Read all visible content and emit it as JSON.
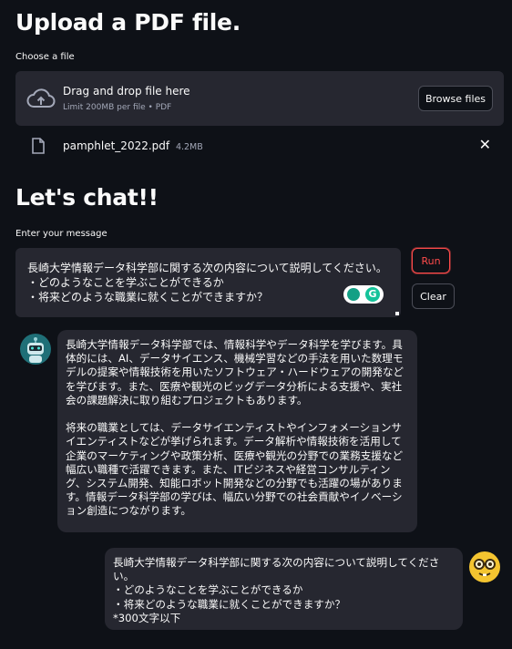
{
  "upload_section": {
    "heading": "Upload a PDF file.",
    "label": "Choose a file",
    "dropzone_title": "Drag and drop file here",
    "dropzone_subtitle": "Limit 200MB per file • PDF",
    "browse_button": "Browse files",
    "upload_icon": "cloud-upload-icon"
  },
  "uploaded_file": {
    "name": "pamphlet_2022.pdf",
    "size": "4.2MB",
    "file_icon": "file-icon",
    "remove_icon": "close-icon",
    "remove_glyph": "✕"
  },
  "chat_section": {
    "heading": "Let's chat!!",
    "input_label": "Enter your message",
    "input_value": "長崎大学情報データ科学部に関する次の内容について説明してください。\n・どのようなことを学ぶことができるか\n・将来どのような職業に就くことができますか？",
    "run_button": "Run",
    "clear_button": "Clear",
    "grammar_glyph": "G"
  },
  "messages": [
    {
      "role": "assistant",
      "avatar_icon": "robot-avatar-icon",
      "text": "長崎大学情報データ科学部では、情報科学やデータ科学を学びます。具体的には、AI、データサイエンス、機械学習などの手法を用いた数理モデルの提案や情報技術を用いたソフトウェア・ハードウェアの開発などを学びます。また、医療や観光のビッグデータ分析による支援や、実社会の課題解決に取り組むプロジェクトもあります。\n\n将来の職業としては、データサイエンティストやインフォメーションサイエンティストなどが挙げられます。データ解析や情報技術を活用して企業のマーケティングや政策分析、医療や観光の分野での業務支援など幅広い職種で活躍できます。また、ITビジネスや経営コンサルティング、システム開発、知能ロボット開発などの分野でも活躍の場があります。情報データ科学部の学びは、幅広い分野での社会貢献やイノベーション創造につながります。"
    },
    {
      "role": "user",
      "avatar_icon": "nerd-face-avatar-icon",
      "text": "長崎大学情報データ科学部に関する次の内容について説明してください。\n・どのようなことを学ぶことができるか\n・将来どのような職業に就くことができますか？\n*300文字以下"
    }
  ],
  "colors": {
    "background": "#0e1117",
    "surface": "#262730",
    "accent": "#ff4b4b",
    "text": "#fafafa",
    "muted": "#a3a8b8"
  }
}
